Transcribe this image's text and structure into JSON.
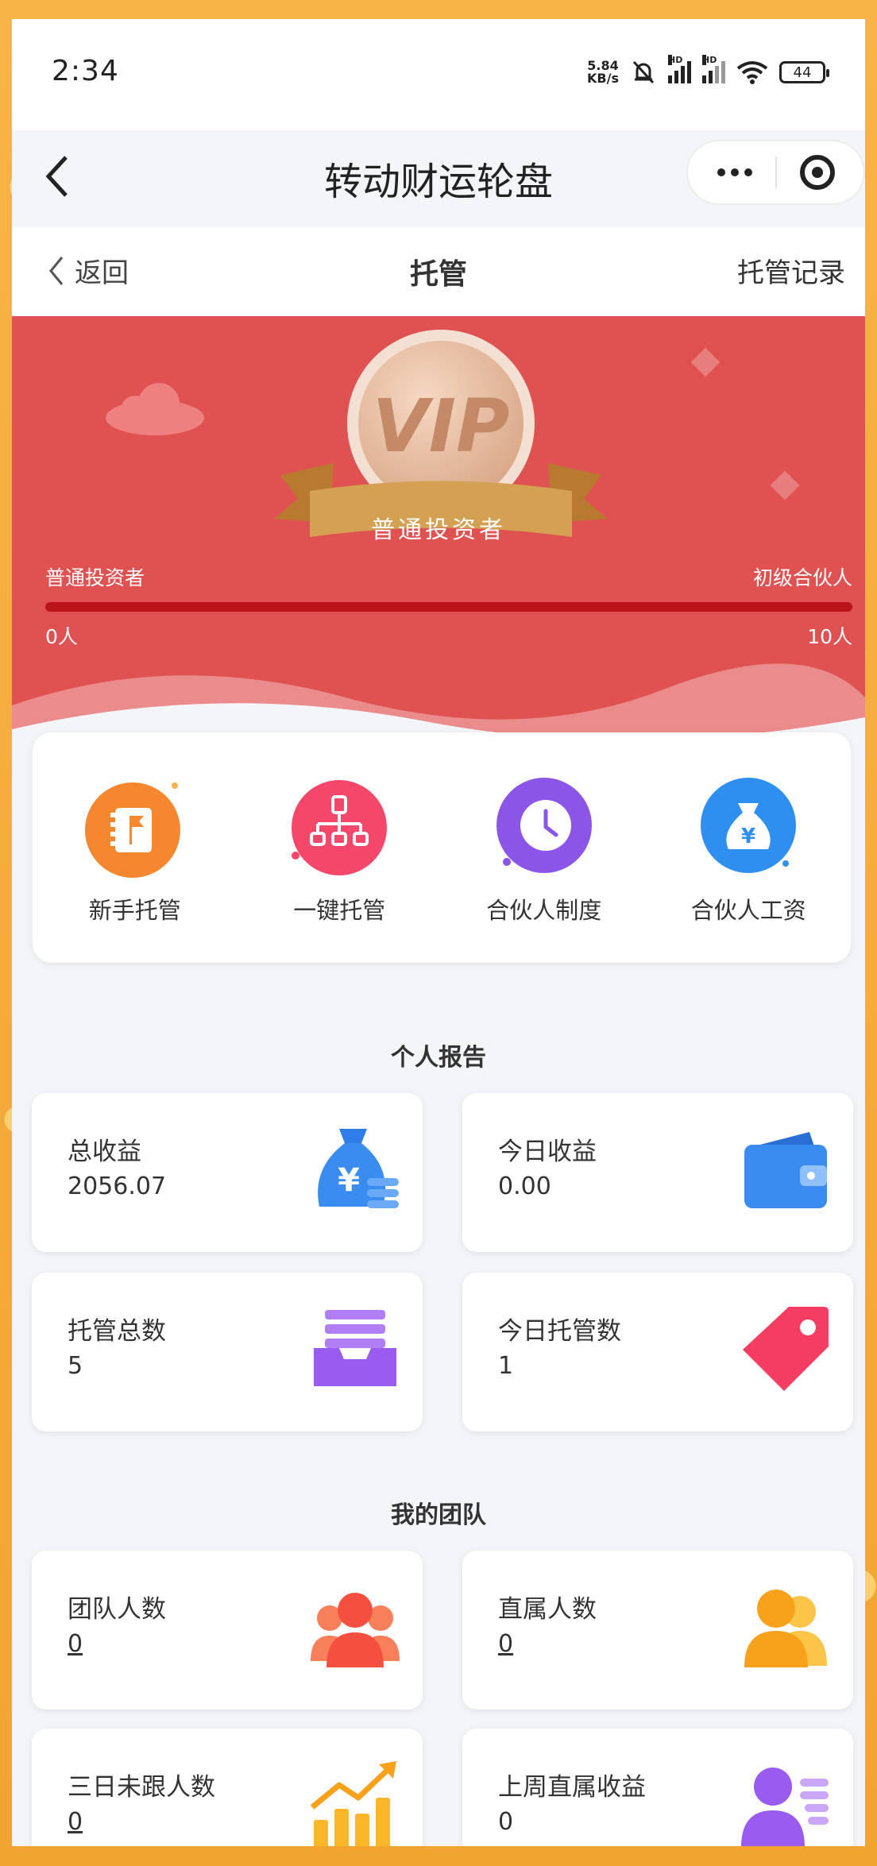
{
  "status_bar": {
    "time": "2:34",
    "net_speed_value": "5.84",
    "net_speed_unit": "KB/s",
    "sim1_badge": "HD",
    "sim2_badge": "HD",
    "battery": "44"
  },
  "miniprogram": {
    "title": "转动财运轮盘"
  },
  "page_header": {
    "back_label": "返回",
    "title": "托管",
    "record_label": "托管记录"
  },
  "vip": {
    "badge_text": "VIP",
    "current_level": "普通投资者",
    "level_start": "普通投资者",
    "level_next": "初级合伙人",
    "count_start": "0人",
    "count_next": "10人",
    "progress": 0
  },
  "quick_menu": [
    {
      "label": "新手托管",
      "icon": "guide-book-icon"
    },
    {
      "label": "一键托管",
      "icon": "org-chart-icon"
    },
    {
      "label": "合伙人制度",
      "icon": "clock-icon"
    },
    {
      "label": "合伙人工资",
      "icon": "money-bag-icon"
    }
  ],
  "personal_report": {
    "title": "个人报告",
    "cards": [
      {
        "label": "总收益",
        "value": "2056.07",
        "icon": "money-bag-coins-icon"
      },
      {
        "label": "今日收益",
        "value": "0.00",
        "icon": "wallet-icon"
      },
      {
        "label": "托管总数",
        "value": "5",
        "icon": "inbox-tray-icon"
      },
      {
        "label": "今日托管数",
        "value": "1",
        "icon": "price-tag-icon"
      }
    ]
  },
  "my_team": {
    "title": "我的团队",
    "cards": [
      {
        "label": "团队人数",
        "value": "0",
        "icon": "team-icon"
      },
      {
        "label": "直属人数",
        "value": "0",
        "icon": "users-icon"
      },
      {
        "label": "三日未跟人数",
        "value": "0",
        "icon": "trend-chart-icon"
      },
      {
        "label": "上周直属收益",
        "value": "0",
        "icon": "user-list-icon"
      }
    ]
  },
  "colors": {
    "banner_red": "#e05252",
    "progress_track": "#b8141a",
    "frame_gold": "#f6ad3c",
    "page_bg": "#f4f5f9"
  }
}
